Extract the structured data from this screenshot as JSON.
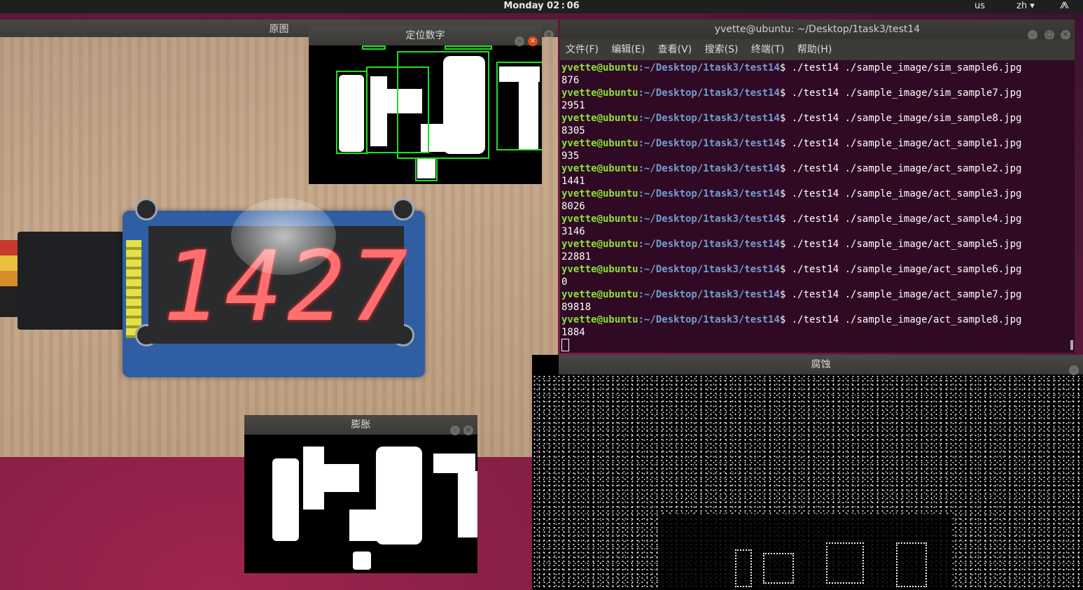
{
  "topbar": {
    "clock": "Monday 02 : 06",
    "keyboard": "us",
    "lang": "zh ▾",
    "net_icon": "⨇"
  },
  "windows": {
    "original": {
      "title": "原图",
      "display": "1427"
    },
    "locate": {
      "title": "定位数字"
    },
    "dilate": {
      "title": "膨胀"
    },
    "erode": {
      "title": "腐蚀"
    },
    "terminal": {
      "title": "yvette@ubuntu: ~/Desktop/1task3/test14",
      "menu": [
        "文件(F)",
        "编辑(E)",
        "查看(V)",
        "搜索(S)",
        "终端(T)",
        "帮助(H)"
      ],
      "prompt_user": "yvette@ubuntu",
      "prompt_path": ":~/Desktop/1task3/test14",
      "prompt_symbol": "$",
      "lines": [
        {
          "cmd": " ./test14 ./sample_image/sim_sample6.jpg",
          "out": "876"
        },
        {
          "cmd": " ./test14 ./sample_image/sim_sample7.jpg",
          "out": "2951"
        },
        {
          "cmd": " ./test14 ./sample_image/sim_sample8.jpg",
          "out": "8305"
        },
        {
          "cmd": " ./test14 ./sample_image/act_sample1.jpg",
          "out": "935"
        },
        {
          "cmd": " ./test14 ./sample_image/act_sample2.jpg",
          "out": "1441"
        },
        {
          "cmd": " ./test14 ./sample_image/act_sample3.jpg",
          "out": "8026"
        },
        {
          "cmd": " ./test14 ./sample_image/act_sample4.jpg",
          "out": "3146"
        },
        {
          "cmd": " ./test14 ./sample_image/act_sample5.jpg",
          "out": "22881"
        },
        {
          "cmd": " ./test14 ./sample_image/act_sample6.jpg",
          "out": "0"
        },
        {
          "cmd": " ./test14 ./sample_image/act_sample7.jpg",
          "out": "89818"
        },
        {
          "cmd": " ./test14 ./sample_image/act_sample8.jpg",
          "out": "1884"
        }
      ]
    }
  },
  "icons": {
    "minimize": "–",
    "maximize": "□",
    "close": "×"
  }
}
